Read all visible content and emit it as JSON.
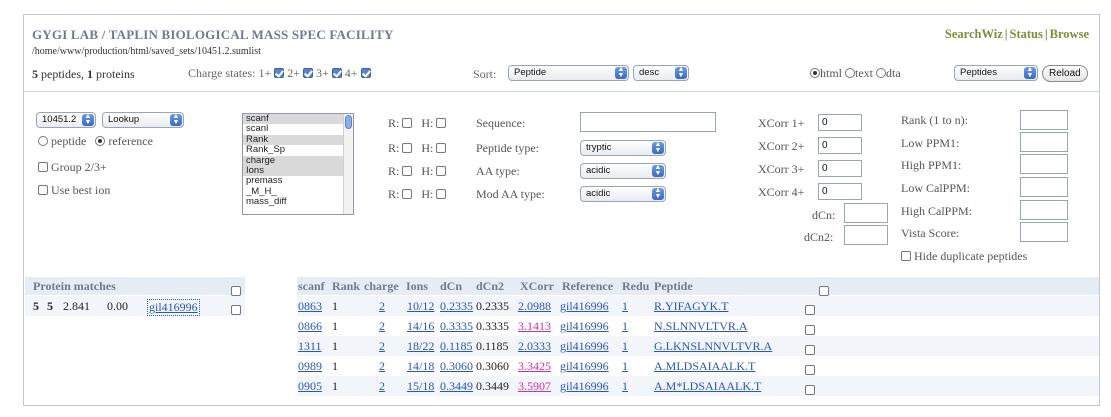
{
  "header": {
    "title": "GYGI LAB / TAPLIN BIOLOGICAL MASS SPEC FACILITY",
    "path": "/home/www/production/html/saved_sets/10451.2.sumlist",
    "nav": [
      "SearchWiz",
      "Status",
      "Browse"
    ],
    "nav_sep": "|"
  },
  "summary": {
    "peptides_count": "5",
    "peptides_label": "peptides,",
    "proteins_count": "1",
    "proteins_label": "proteins"
  },
  "charge_states": {
    "label": "Charge states:",
    "items": [
      {
        "label": "1+",
        "checked": true
      },
      {
        "label": "2+",
        "checked": true
      },
      {
        "label": "3+",
        "checked": true
      },
      {
        "label": "4+",
        "checked": true
      }
    ]
  },
  "sort": {
    "label": "Sort:",
    "field": "Peptide",
    "order": "desc"
  },
  "output_format": {
    "options": [
      "html",
      "text",
      "dta"
    ],
    "selected": "html",
    "dta_select": "Peptides",
    "reload_label": "Reload"
  },
  "filters": {
    "set_select": "10451.2",
    "mode_select": "Lookup",
    "radio_peptide": "peptide",
    "radio_reference": "reference",
    "group_label": "Group 2/3+",
    "best_ion_label": "Use best ion",
    "field_list": [
      "scanf",
      "scanl",
      "Rank",
      "Rank_Sp",
      "charge",
      "Ions",
      "premass",
      "_M_H_",
      "mass_diff"
    ],
    "field_list_highlighted": [
      "scanf",
      "Rank",
      "charge",
      "Ions"
    ],
    "r_label": "R:",
    "h_label": "H:",
    "sequence_label": "Sequence:",
    "sequence_value": "",
    "peptide_type_label": "Peptide type:",
    "peptide_type": "tryptic",
    "aa_type_label": "AA type:",
    "aa_type": "acidic",
    "mod_aa_type_label": "Mod AA type:",
    "mod_aa_type": "acidic",
    "xcorr": [
      {
        "label": "XCorr 1+",
        "value": "0"
      },
      {
        "label": "XCorr 2+",
        "value": "0"
      },
      {
        "label": "XCorr 3+",
        "value": "0"
      },
      {
        "label": "XCorr 4+",
        "value": "0"
      }
    ],
    "dcn_label": "dCn:",
    "dcn2_label": "dCn2:",
    "right_labels": [
      "Rank (1 to n):",
      "Low PPM1:",
      "High PPM1:",
      "Low CalPPM:",
      "High CalPPM:",
      "Vista Score:"
    ],
    "hide_dup_label": "Hide duplicate peptides"
  },
  "protein_table": {
    "header": "Protein matches",
    "row": {
      "a": "5",
      "b": "5",
      "score": "2.841",
      "val": "0.00",
      "ref": "gil416996"
    }
  },
  "results": {
    "columns": [
      "scanf",
      "Rank",
      "charge",
      "Ions",
      "dCn",
      "dCn2",
      "XCorr",
      "Reference",
      "Redu",
      "Peptide"
    ],
    "rows": [
      {
        "scanf": "0863",
        "rank": "1",
        "charge": "2",
        "ions": "10/12",
        "dcn": "0.2335",
        "dcn2": "0.2335",
        "xcorr": "2.0988",
        "ref": "gil416996",
        "redu": "1",
        "peptide": "R.YIFAGYK.T",
        "xcorr_pink": false
      },
      {
        "scanf": "0866",
        "rank": "1",
        "charge": "2",
        "ions": "14/16",
        "dcn": "0.3335",
        "dcn2": "0.3335",
        "xcorr": "3.1413",
        "ref": "gil416996",
        "redu": "1",
        "peptide": "N.SLNNVLTVR.A",
        "xcorr_pink": true
      },
      {
        "scanf": "1311",
        "rank": "1",
        "charge": "2",
        "ions": "18/22",
        "dcn": "0.1185",
        "dcn2": "0.1185",
        "xcorr": "2.0333",
        "ref": "gil416996",
        "redu": "1",
        "peptide": "G.LKNSLNNVLTVR.A",
        "xcorr_pink": false
      },
      {
        "scanf": "0989",
        "rank": "1",
        "charge": "2",
        "ions": "14/18",
        "dcn": "0.3060",
        "dcn2": "0.3060",
        "xcorr": "3.3425",
        "ref": "gil416996",
        "redu": "1",
        "peptide": "A.MLDSAIAALK.T",
        "xcorr_pink": true
      },
      {
        "scanf": "0905",
        "rank": "1",
        "charge": "2",
        "ions": "15/18",
        "dcn": "0.3449",
        "dcn2": "0.3449",
        "xcorr": "3.5907",
        "ref": "gil416996",
        "redu": "1",
        "peptide": "A.M*LDSAIAALK.T",
        "xcorr_pink": true
      }
    ]
  },
  "colors": {
    "title": "#6e7c8e",
    "nav": "#7f8c3a",
    "link": "#2a56b5",
    "pink": "#cc3399",
    "header_bg": "#e6ecf4"
  }
}
